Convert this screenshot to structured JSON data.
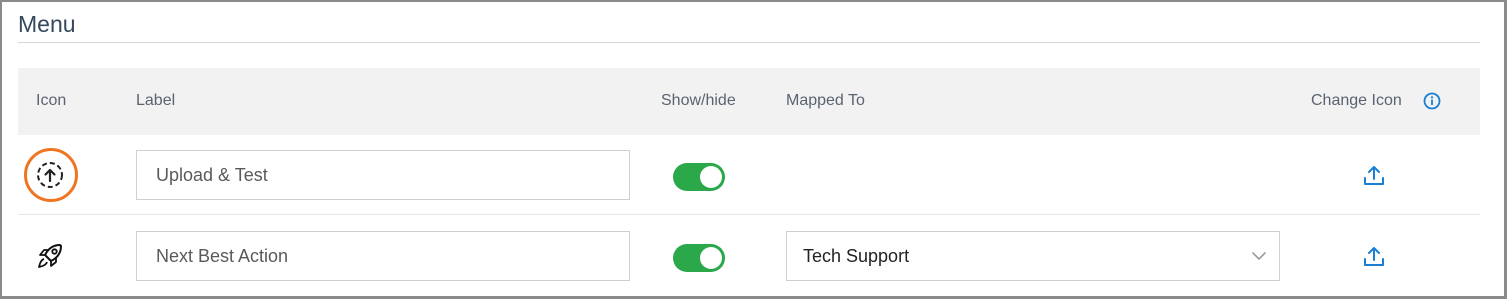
{
  "section": {
    "title": "Menu"
  },
  "table": {
    "headers": {
      "icon": "Icon",
      "label": "Label",
      "show_hide": "Show/hide",
      "mapped_to": "Mapped To",
      "change_icon": "Change Icon"
    },
    "rows": [
      {
        "icon": "upload-circle-icon",
        "label": "Upload & Test",
        "show": true,
        "mapped_to": "",
        "highlighted": true
      },
      {
        "icon": "rocket-icon",
        "label": "Next Best Action",
        "show": true,
        "mapped_to": "Tech Support",
        "highlighted": false
      }
    ]
  },
  "colors": {
    "toggle_on": "#2aa84a",
    "accent_blue": "#1a7fd4",
    "highlight": "#f07522"
  }
}
